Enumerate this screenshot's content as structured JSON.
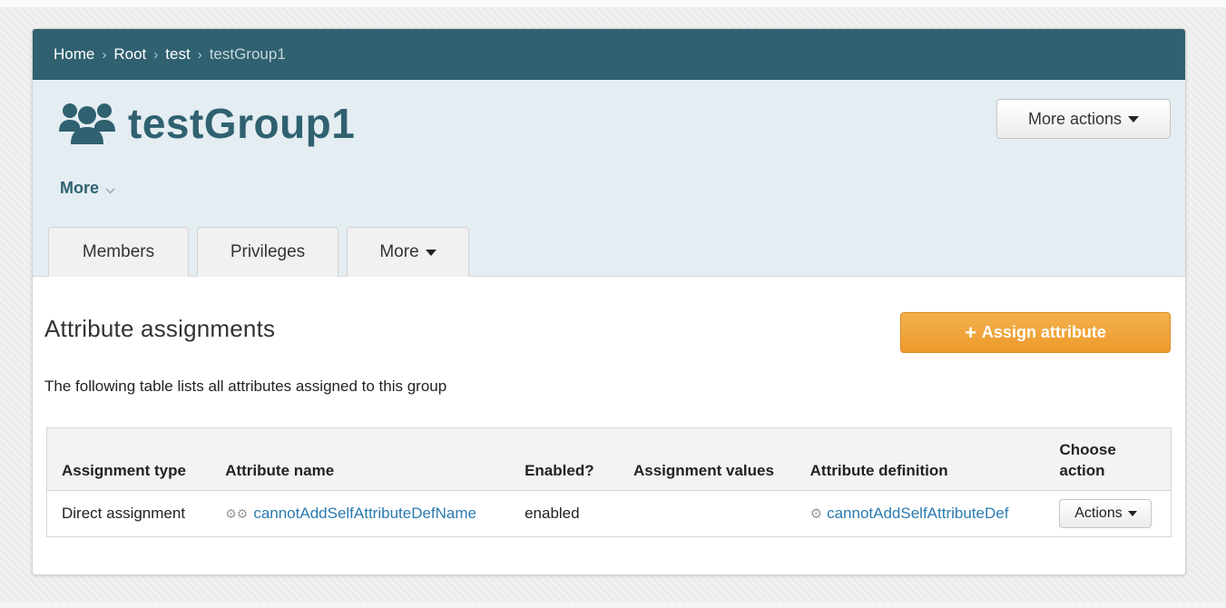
{
  "breadcrumb": {
    "items": [
      "Home",
      "Root",
      "test"
    ],
    "separator": "›",
    "current": "testGroup1"
  },
  "header": {
    "title": "testGroup1",
    "more_actions_label": "More actions",
    "more_link_label": "More",
    "icon": "group-icon"
  },
  "tabs": [
    {
      "label": "Members"
    },
    {
      "label": "Privileges"
    },
    {
      "label": "More"
    }
  ],
  "section": {
    "title": "Attribute assignments",
    "assign_button_label": "Assign attribute",
    "description": "The following table lists all attributes assigned to this group"
  },
  "table": {
    "columns": [
      "Assignment type",
      "Attribute name",
      "Enabled?",
      "Assignment values",
      "Attribute definition",
      "Choose action"
    ],
    "rows": [
      {
        "assignment_type": "Direct assignment",
        "attribute_name": "cannotAddSelfAttributeDefName",
        "enabled": "enabled",
        "assignment_values": "",
        "attribute_definition": "cannotAddSelfAttributeDef",
        "action_label": "Actions"
      }
    ]
  },
  "colors": {
    "brand": "#2f6170",
    "header_bg": "#e4edf2",
    "accent_orange": "#ee9d2d",
    "link": "#2a7ab0"
  }
}
